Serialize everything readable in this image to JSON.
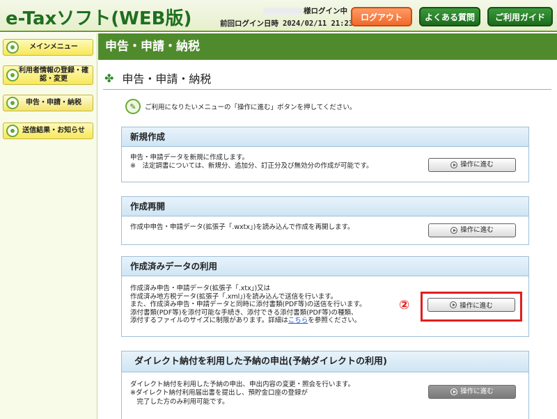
{
  "header": {
    "logo": "e-Taxソフト(WEB版)",
    "login_status_suffix": "様ログイン中",
    "last_login_label": "前回ログイン日時",
    "last_login_value": "2024/02/11 21:23",
    "logout_label": "ログアウト",
    "faq_label": "よくある質問",
    "guide_label": "ご利用ガイド"
  },
  "sidebar": {
    "items": [
      {
        "label": "メインメニュー"
      },
      {
        "label": "利用者情報の登録・確認・変更"
      },
      {
        "label": "申告・申請・納税"
      },
      {
        "label": "送信結果・お知らせ"
      }
    ]
  },
  "main": {
    "title": "申告・申請・納税",
    "heading": "申告・申請・納税",
    "note": "ご利用になりたいメニューの「操作に進む」ボタンを押してください。",
    "sections": [
      {
        "title": "新規作成",
        "lines": [
          "申告・申請データを新規に作成します。",
          "※　法定調書については、新規分、追加分、訂正分及び無効分の作成が可能です。"
        ],
        "button": "操作に進む"
      },
      {
        "title": "作成再開",
        "lines": [
          "作成中申告・申請データ(拡張子「.wxtx」)を読み込んで作成を再開します。"
        ],
        "button": "操作に進む"
      },
      {
        "title": "作成済みデータの利用",
        "lines": [
          "作成済み申告・申請データ(拡張子「.xtx」)又は",
          "作成済み地方税データ(拡張子「.xml」)を読み込んで送信を行います。",
          "また、作成済み申告・申請データと同時に添付書類(PDF等)の送信を行います。",
          "添付書類(PDF等)を添付可能な手続き、添付できる添付書類(PDF等)の種類、",
          "添付するファイルのサイズに制限があります。詳細は"
        ],
        "link_text": "こちら",
        "after_link": "を参照ください。",
        "button": "操作に進む",
        "annotation": "②"
      },
      {
        "title": "ダイレクト納付を利用した予納の申出(予納ダイレクトの利用)",
        "lines": [
          "ダイレクト納付を利用した予納の申出、申出内容の変更・照会を行います。",
          "※ダイレクト納付利用届出書を提出し、預貯金口座の登録が",
          "　完了した方のみ利用可能です。"
        ],
        "button": "操作に進む"
      }
    ]
  },
  "colors": {
    "brand_green": "#1f6f1f",
    "title_bar": "#4f8b2c",
    "logout_orange": "#f06a2a",
    "highlight_red": "#e01e1e"
  }
}
